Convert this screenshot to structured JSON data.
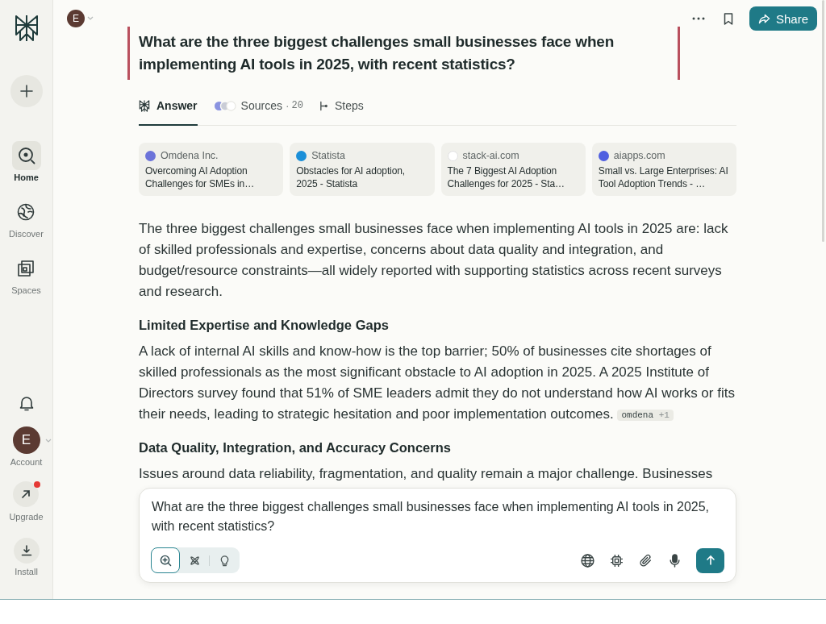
{
  "sidebar": {
    "items": [
      {
        "kind": "home",
        "label": "Home",
        "selected": true
      },
      {
        "kind": "discover",
        "label": "Discover",
        "selected": false
      },
      {
        "kind": "spaces",
        "label": "Spaces",
        "selected": false
      }
    ],
    "account": {
      "initial": "E",
      "label": "Account"
    },
    "upgrade": {
      "label": "Upgrade",
      "notification": true
    },
    "install": {
      "label": "Install"
    }
  },
  "header": {
    "user_initial": "E",
    "share_label": "Share"
  },
  "question": "What are the three biggest challenges small businesses face when implementing AI tools in 2025, with recent statistics?",
  "tabs": [
    {
      "kind": "answer",
      "label": "Answer",
      "selected": true
    },
    {
      "kind": "sources",
      "label": "Sources",
      "separator": "·",
      "count": "20",
      "selected": false
    },
    {
      "kind": "steps",
      "label": "Steps",
      "selected": false
    }
  ],
  "sources": [
    {
      "site": "Omdena Inc.",
      "color": "#6b73d9",
      "title": "Overcoming AI Adoption Challenges for SMEs in…"
    },
    {
      "site": "Statista",
      "color": "#1b8fd8",
      "title": "Obstacles for AI adoption, 2025 - Statista"
    },
    {
      "site": "stack-ai.com",
      "color": "#ffffff",
      "title": "The 7 Biggest AI Adoption Challenges for 2025 - Sta…"
    },
    {
      "site": "aiapps.com",
      "color": "#4f5fe0",
      "title": "Small vs. Large Enterprises: AI Tool Adoption Trends - …"
    }
  ],
  "answer": {
    "intro": "The three biggest challenges small businesses face when implementing AI tools in 2025 are: lack of skilled professionals and expertise, concerns about data quality and integration, and budget/resource constraints—all widely reported with supporting statistics across recent surveys and research.",
    "sections": [
      {
        "heading": "Limited Expertise and Knowledge Gaps",
        "text": "A lack of internal AI skills and know-how is the top barrier; 50% of businesses cite shortages of skilled professionals as the most significant obstacle to AI adoption in 2025. A 2025 Institute of Directors survey found that 51% of SME leaders admit they do not understand how AI works or fits their needs, leading to strategic hesitation and poor implementation outcomes.",
        "citation": {
          "source": "omdena",
          "extra": "+1"
        }
      },
      {
        "heading": "Data Quality, Integration, and Accuracy Concerns",
        "text": "Issues around data reliability, fragmentation, and quality remain a major challenge. Businesses"
      }
    ]
  },
  "composer": {
    "value": "What are the three biggest challenges small businesses face when implementing AI tools in 2025, with recent statistics?",
    "modes": [
      {
        "kind": "search",
        "selected": true
      },
      {
        "kind": "research",
        "selected": false
      },
      {
        "kind": "labs",
        "selected": false
      }
    ]
  }
}
